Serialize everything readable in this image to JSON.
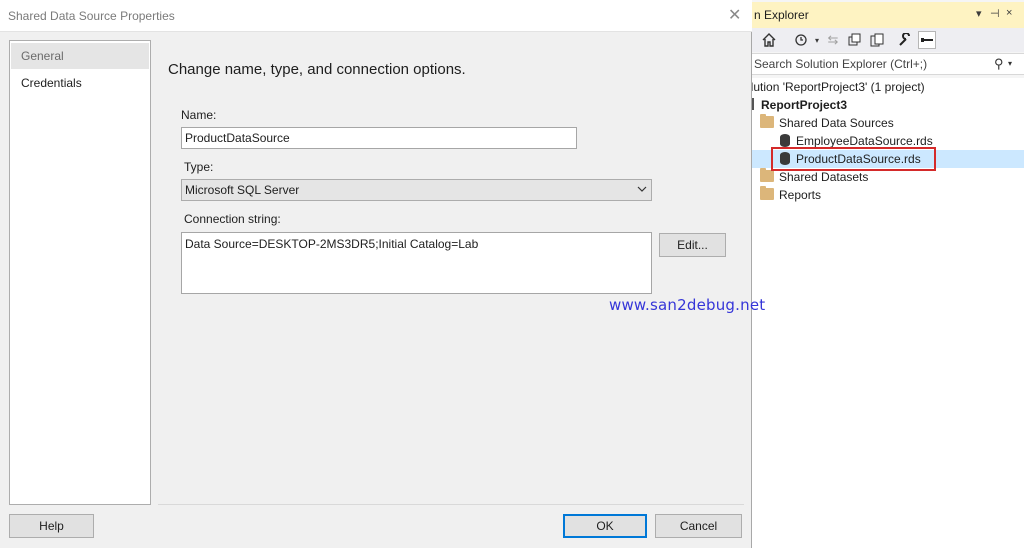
{
  "solution_explorer": {
    "title": "n Explorer",
    "title_controls": [
      "▾",
      "⊣",
      "×"
    ],
    "search_placeholder": "Search Solution Explorer (Ctrl+;)",
    "tree": [
      {
        "label": "olution 'ReportProject3' (1 project)",
        "icon": "solution-icon",
        "indent": 0,
        "bold": false
      },
      {
        "label": "ReportProject3",
        "icon": "project-icon",
        "indent": 1,
        "bold": true
      },
      {
        "label": "Shared Data Sources",
        "icon": "folder-icon",
        "indent": 2,
        "bold": false
      },
      {
        "label": "EmployeeDataSource.rds",
        "icon": "datasource-icon",
        "indent": 3,
        "bold": false
      },
      {
        "label": "ProductDataSource.rds",
        "icon": "datasource-icon",
        "indent": 3,
        "bold": false,
        "selected": true
      },
      {
        "label": "Shared Datasets",
        "icon": "folder-icon",
        "indent": 2,
        "bold": false
      },
      {
        "label": "Reports",
        "icon": "folder-icon",
        "indent": 2,
        "bold": false
      }
    ]
  },
  "dialog": {
    "title": "Shared Data Source Properties",
    "close_glyph": "✕",
    "nav": [
      {
        "label": "General",
        "selected": true
      },
      {
        "label": "Credentials",
        "selected": false
      }
    ],
    "heading": "Change name, type, and connection options.",
    "name_label": "Name:",
    "name_value": "ProductDataSource",
    "type_label": "Type:",
    "type_value": "Microsoft SQL Server",
    "connection_label": "Connection string:",
    "connection_value": "Data Source=DESKTOP-2MS3DR5;Initial Catalog=Lab",
    "edit_button": "Edit...",
    "help_button": "Help",
    "ok_button": "OK",
    "cancel_button": "Cancel"
  },
  "watermark": "www.san2debug.net",
  "colors": {
    "selection_outline": "#d42a2a",
    "watermark": "#3535d8",
    "ok_border": "#0078d7"
  }
}
